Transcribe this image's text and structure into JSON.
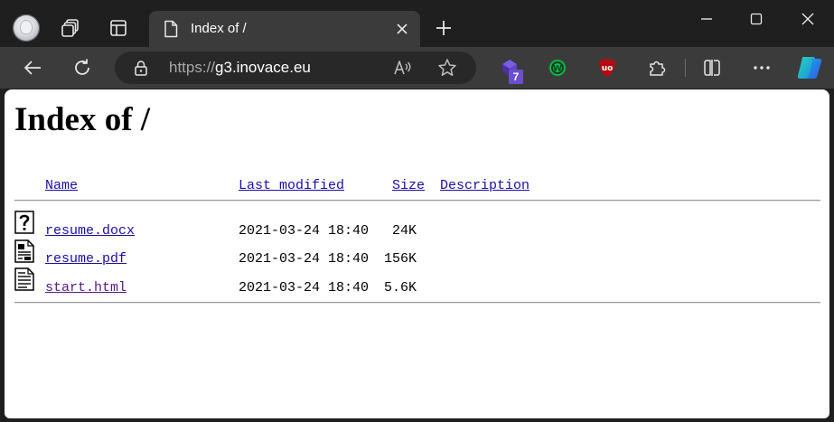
{
  "browser": {
    "tab": {
      "title": "Index of /"
    },
    "address_bar": {
      "url_scheme": "https://",
      "url_host": "g3.inovace.eu"
    },
    "extensions": {
      "badge_count": "7"
    },
    "icons": {
      "profile": "profile-avatar",
      "workspaces": "workspaces-icon",
      "tab_actions": "vertical-tabs-icon",
      "tab_page": "page-document-icon",
      "tab_close": "close-icon",
      "new_tab": "plus-icon",
      "minimize": "minimize-icon",
      "maximize": "maximize-icon",
      "window_close": "close-window-icon",
      "back": "back-arrow-icon",
      "refresh": "refresh-icon",
      "lock": "lock-icon",
      "read_aloud": "read-aloud-icon",
      "favorite": "star-icon",
      "split": "split-screen-icon",
      "more": "more-icon",
      "copilot": "copilot-icon"
    }
  },
  "page": {
    "heading": "Index of /",
    "columns": {
      "name": "Name",
      "last_modified": "Last modified",
      "size": "Size",
      "description": "Description"
    },
    "files": [
      {
        "name": "resume.docx",
        "modified": "2021-03-24 18:40",
        "size": "24K",
        "icon": "unknown-file-icon"
      },
      {
        "name": "resume.pdf",
        "modified": "2021-03-24 18:40",
        "size": "156K",
        "icon": "layout-file-icon"
      },
      {
        "name": "start.html",
        "modified": "2021-03-24 18:40",
        "size": "5.6K",
        "icon": "text-file-icon"
      }
    ]
  },
  "colors": {
    "chrome_dark": "#1f1f1f",
    "toolbar": "#3b3b3b",
    "omnibox": "#282828",
    "link": "#1a0dab",
    "visited_link": "#551a8b"
  }
}
